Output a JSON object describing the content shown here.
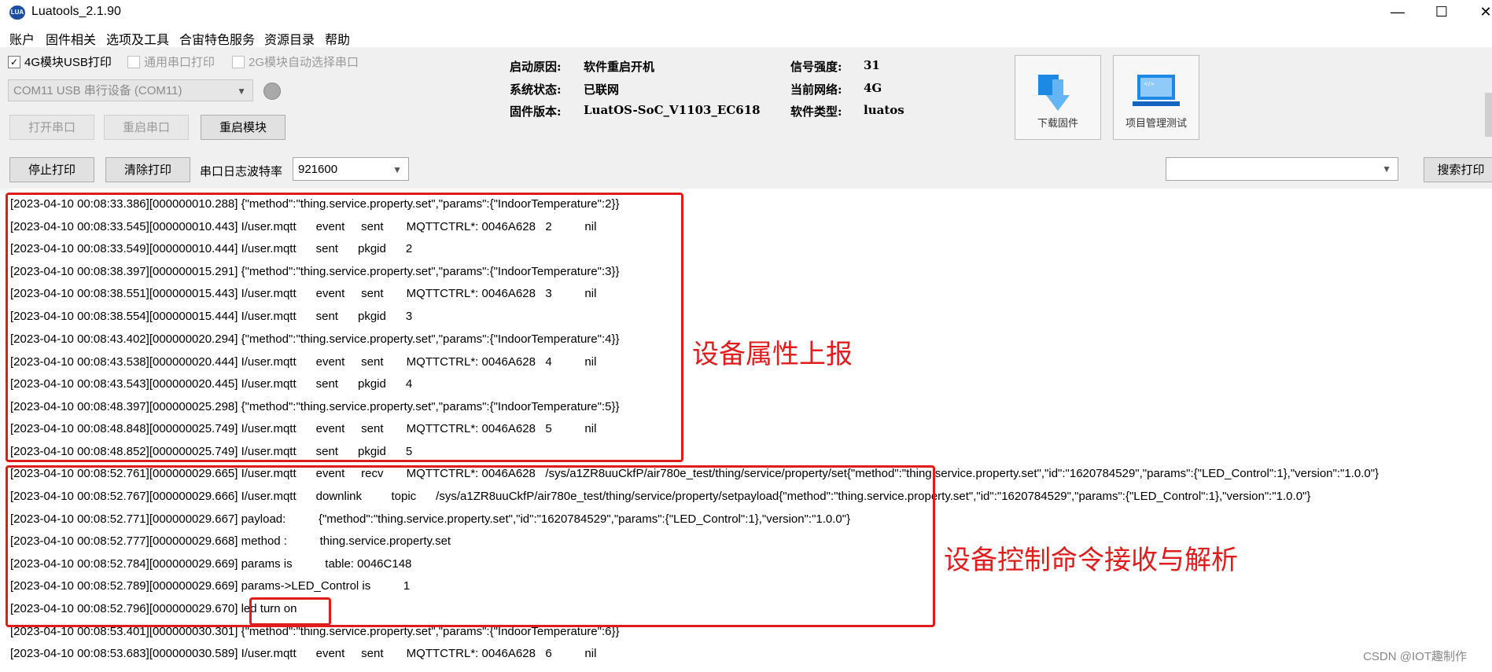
{
  "window": {
    "title": "Luatools_2.1.90",
    "minimize": "—",
    "maximize": "☐",
    "close": "✕"
  },
  "menu": [
    "账户",
    "固件相关",
    "选项及工具",
    "合宙特色服务",
    "资源目录",
    "帮助"
  ],
  "options": {
    "usb_print": {
      "label": "4G模块USB打印",
      "checked": "✓"
    },
    "serial_print": {
      "label": "通用串口打印"
    },
    "auto_select": {
      "label": "2G模块自动选择串口"
    }
  },
  "port": {
    "value": "COM11 USB 串行设备 (COM11)"
  },
  "buttons": {
    "open_port": "打开串口",
    "restart_port": "重启串口",
    "restart_module": "重启模块",
    "stop_print": "停止打印",
    "clear_print": "清除打印",
    "search_print": "搜索打印",
    "download_firmware": "下载固件",
    "project_test": "项目管理测试"
  },
  "baud": {
    "label": "串口日志波特率",
    "value": "921600"
  },
  "status": {
    "boot_reason_label": "启动原因:",
    "boot_reason": "软件重启开机",
    "system_label": "系统状态:",
    "system": "已联网",
    "firmware_label": "固件版本:",
    "firmware": "LuatOS-SoC_V1103_EC618",
    "signal_label": "信号强度:",
    "signal": "31",
    "network_label": "当前网络:",
    "network": "4G",
    "software_label": "软件类型:",
    "software": "luatos"
  },
  "logs": [
    "[2023-04-10 00:08:33.386][000000010.288] {\"method\":\"thing.service.property.set\",\"params\":{\"IndoorTemperature\":2}}",
    "[2023-04-10 00:08:33.545][000000010.443] I/user.mqtt      event     sent       MQTTCTRL*: 0046A628   2          nil",
    "[2023-04-10 00:08:33.549][000000010.444] I/user.mqtt      sent      pkgid      2",
    "[2023-04-10 00:08:38.397][000000015.291] {\"method\":\"thing.service.property.set\",\"params\":{\"IndoorTemperature\":3}}",
    "[2023-04-10 00:08:38.551][000000015.443] I/user.mqtt      event     sent       MQTTCTRL*: 0046A628   3          nil",
    "[2023-04-10 00:08:38.554][000000015.444] I/user.mqtt      sent      pkgid      3",
    "[2023-04-10 00:08:43.402][000000020.294] {\"method\":\"thing.service.property.set\",\"params\":{\"IndoorTemperature\":4}}",
    "[2023-04-10 00:08:43.538][000000020.444] I/user.mqtt      event     sent       MQTTCTRL*: 0046A628   4          nil",
    "[2023-04-10 00:08:43.543][000000020.445] I/user.mqtt      sent      pkgid      4",
    "[2023-04-10 00:08:48.397][000000025.298] {\"method\":\"thing.service.property.set\",\"params\":{\"IndoorTemperature\":5}}",
    "[2023-04-10 00:08:48.848][000000025.749] I/user.mqtt      event     sent       MQTTCTRL*: 0046A628   5          nil",
    "[2023-04-10 00:08:48.852][000000025.749] I/user.mqtt      sent      pkgid      5",
    "[2023-04-10 00:08:52.761][000000029.665] I/user.mqtt      event     recv       MQTTCTRL*: 0046A628   /sys/a1ZR8uuCkfP/air780e_test/thing/service/property/set{\"method\":\"thing.service.property.set\",\"id\":\"1620784529\",\"params\":{\"LED_Control\":1},\"version\":\"1.0.0\"}",
    "[2023-04-10 00:08:52.767][000000029.666] I/user.mqtt      downlink         topic      /sys/a1ZR8uuCkfP/air780e_test/thing/service/property/setpayload{\"method\":\"thing.service.property.set\",\"id\":\"1620784529\",\"params\":{\"LED_Control\":1},\"version\":\"1.0.0\"}",
    "[2023-04-10 00:08:52.771][000000029.667] payload:          {\"method\":\"thing.service.property.set\",\"id\":\"1620784529\",\"params\":{\"LED_Control\":1},\"version\":\"1.0.0\"}",
    "[2023-04-10 00:08:52.777][000000029.668] method :          thing.service.property.set",
    "[2023-04-10 00:08:52.784][000000029.669] params is          table: 0046C148",
    "[2023-04-10 00:08:52.789][000000029.669] params->LED_Control is          1",
    "[2023-04-10 00:08:52.796][000000029.670] led turn on",
    "[2023-04-10 00:08:53.401][000000030.301] {\"method\":\"thing.service.property.set\",\"params\":{\"IndoorTemperature\":6}}",
    "[2023-04-10 00:08:53.683][000000030.589] I/user.mqtt      event     sent       MQTTCTRL*: 0046A628   6          nil"
  ],
  "annotations": {
    "report": "设备属性上报",
    "control": "设备控制命令接收与解析"
  },
  "watermark": "CSDN @IOT趣制作"
}
